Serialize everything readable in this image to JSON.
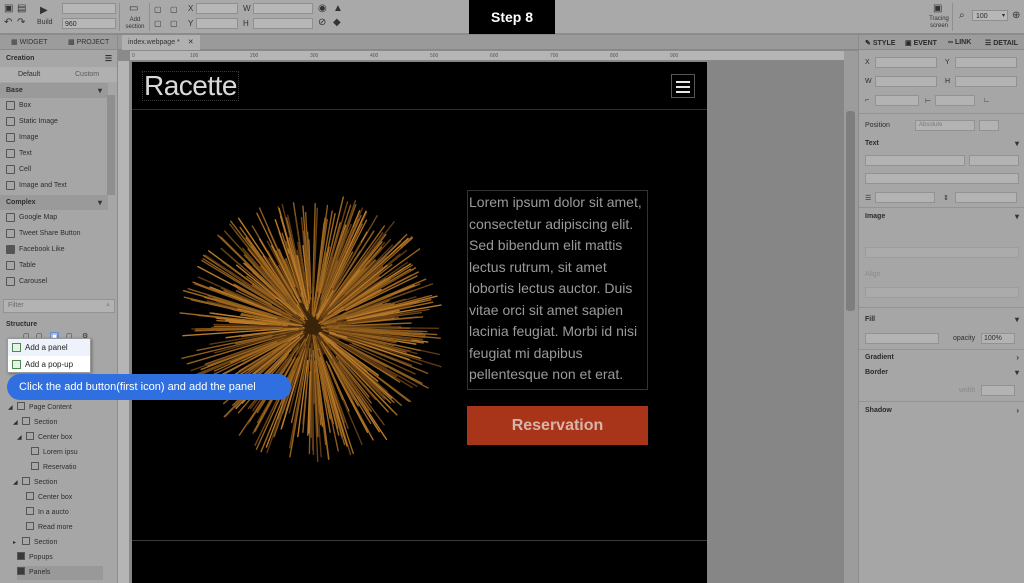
{
  "toolbar": {
    "build_label": "Build",
    "width_value": "960",
    "add_section_label": "Add\nsection",
    "x_label": "X",
    "y_label": "Y",
    "w_label": "W",
    "h_label": "H",
    "tracing_screen_label": "Tracing\nscreen",
    "zoom_value": "100"
  },
  "step_badge": "Step 8",
  "left_panel": {
    "tabs": {
      "widget": "WIDGET",
      "project": "PROJECT"
    },
    "creation_label": "Creation",
    "subtabs": {
      "default": "Default",
      "custom": "Custom"
    },
    "base_header": "Base",
    "base_items": [
      "Box",
      "Static Image",
      "Image",
      "Text",
      "Cell",
      "Image and Text"
    ],
    "complex_header": "Complex",
    "complex_items": [
      "Google Map",
      "Tweet Share Button",
      "Facebook Like",
      "Table",
      "Carousel"
    ],
    "filter_placeholder": "Filter",
    "structure_label": "Structure",
    "add_menu": [
      "Add a panel",
      "Add a pop-up"
    ],
    "tree": [
      {
        "label": "Page Content"
      },
      {
        "label": "Section"
      },
      {
        "label": "Center box"
      },
      {
        "label": "Lorem ipsu"
      },
      {
        "label": "Reservatio"
      },
      {
        "label": "Section"
      },
      {
        "label": "Center box"
      },
      {
        "label": "In a aucto"
      },
      {
        "label": "Read more"
      },
      {
        "label": "Section"
      },
      {
        "label": "Popups"
      },
      {
        "label": "Panels"
      }
    ]
  },
  "instruction": "Click the add button(first icon) and add the panel",
  "document": {
    "tab_label": "index.webpage *",
    "ruler_marks": [
      "0",
      "100",
      "200",
      "300",
      "400",
      "500",
      "600",
      "700",
      "800",
      "900"
    ],
    "logo": "Racette",
    "body_text": "Lorem ipsum dolor sit amet, consectetur adipiscing elit. Sed bibendum elit mattis lectus rutrum, sit amet lobortis lectus auctor. Duis vitae orci sit amet sapien lacinia feugiat. Morbi id nisi feugiat mi dapibus pellentesque non et erat.",
    "button_label": "Reservation"
  },
  "right_panel": {
    "tabs": {
      "style": "STYLE",
      "event": "EVENT",
      "link": "LINK",
      "detail": "DETAIL"
    },
    "x_label": "X",
    "y_label": "Y",
    "w_label": "W",
    "h_label": "H",
    "position_label": "Position",
    "position_value": "Absolute",
    "text_section": "Text",
    "image_section": "Image",
    "align_label": "Align",
    "fill_section": "Fill",
    "opacity_label": "opacity",
    "opacity_value": "100%",
    "gradient_section": "Gradient",
    "border_section": "Border",
    "width_label": "width",
    "shadow_section": "Shadow"
  },
  "colors": {
    "step_badge_bg": "#000000",
    "instruction_bg": "#2f6fe0",
    "reservation_bg": "#a8351a",
    "page_bg": "#000000"
  }
}
